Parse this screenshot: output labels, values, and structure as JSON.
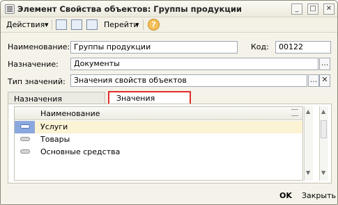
{
  "window": {
    "title": "Элемент Свойства объектов: Группы продукции",
    "buttons": [
      "_",
      "□",
      "✕"
    ]
  },
  "toolbar": {
    "actions_label": "Действия",
    "goto_label": "Перейти",
    "dropdown_icon": "▾",
    "help_icon": "?"
  },
  "form": {
    "name_label": "Наименование:",
    "name_value": "Группы продукции",
    "code_label": "Код:",
    "code_value": "00122",
    "purpose_label": "Назначение:",
    "purpose_value": "Документы",
    "value_type_label": "Тип значений:",
    "value_type_value": "Значения свойств объектов",
    "ellipsis": "...",
    "clear_icon": "✕"
  },
  "tabs": [
    {
      "label": "Назначения свойства"
    },
    {
      "label": "Значения свойства"
    }
  ],
  "table": {
    "header": "Наименование",
    "rows": [
      "Услуги",
      "Товары",
      "Основные средства"
    ]
  },
  "footer": {
    "ok": "OK",
    "close": "Закрыть"
  }
}
